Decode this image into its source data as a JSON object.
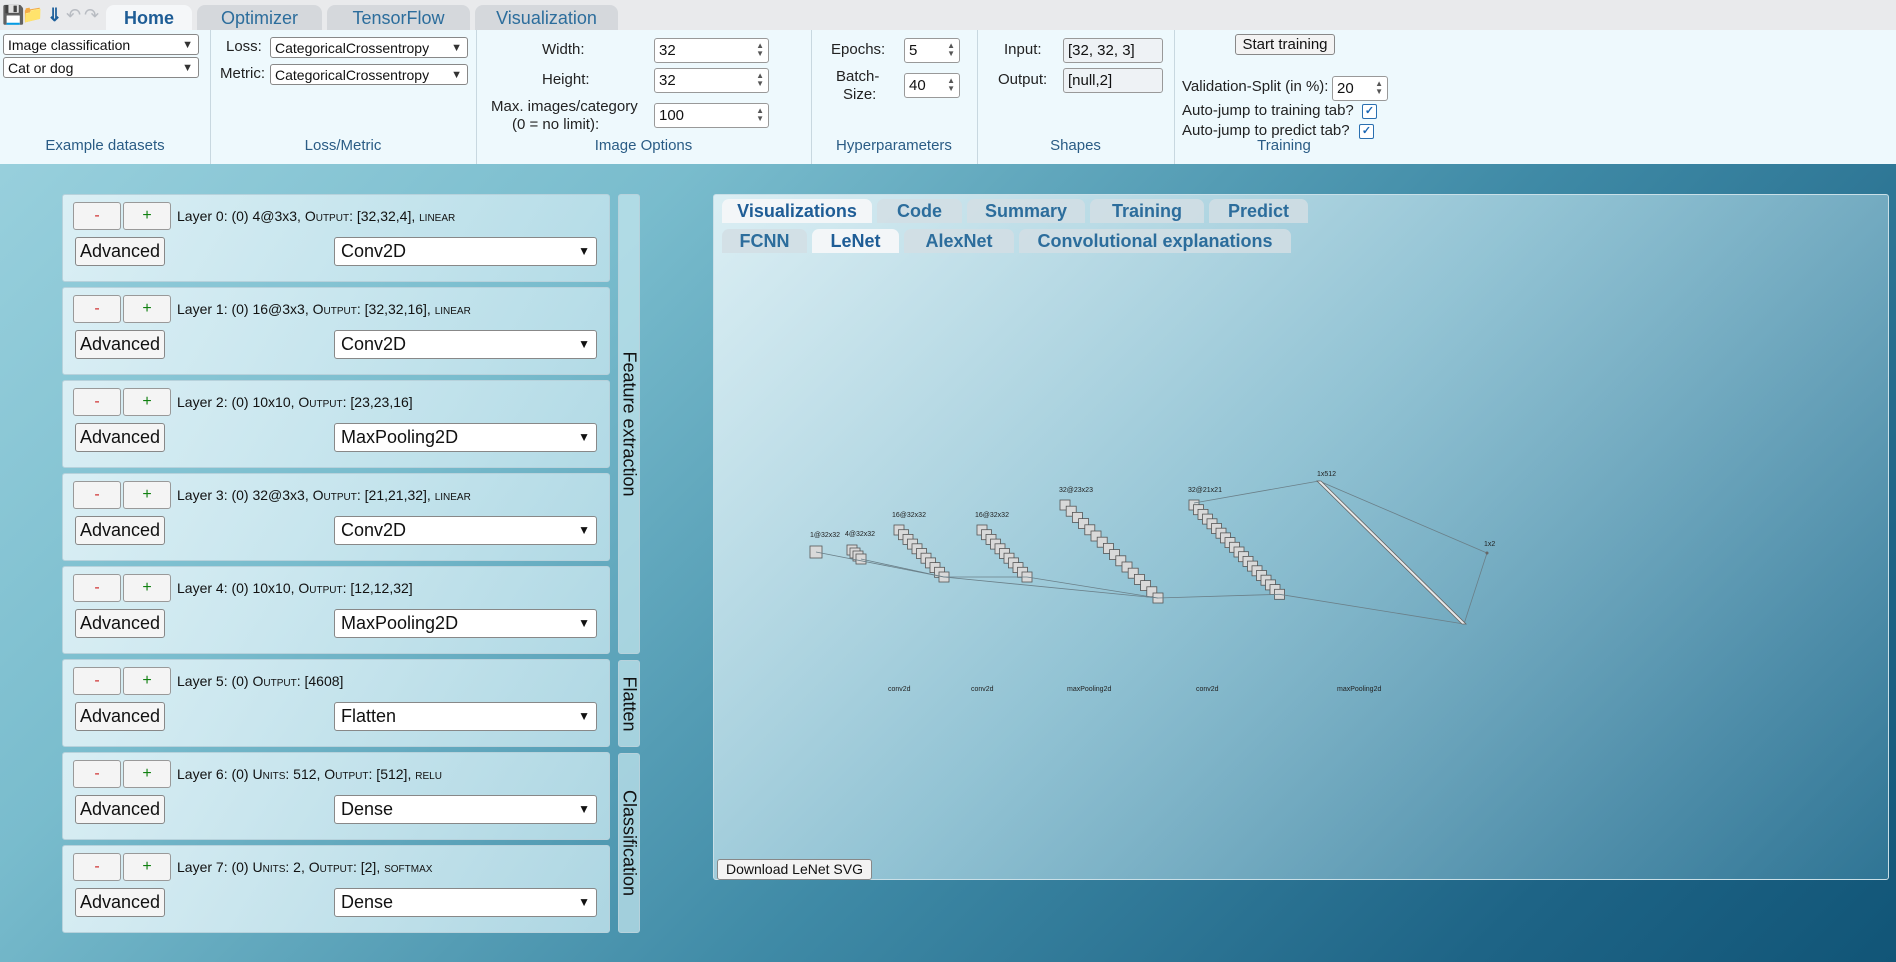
{
  "toolbar": {
    "icons": [
      "save-icon",
      "open-folder-icon",
      "download-icon",
      "undo-icon",
      "redo-icon"
    ],
    "tabs": [
      "Home",
      "Optimizer",
      "TensorFlow",
      "Visualization"
    ],
    "active_tab": "Home"
  },
  "ribbon": {
    "datasets": {
      "category": "Image classification",
      "dataset": "Cat or dog",
      "group_label": "Example datasets"
    },
    "loss_metric": {
      "loss_label": "Loss:",
      "loss_value": "CategoricalCrossentropy",
      "metric_label": "Metric:",
      "metric_value": "CategoricalCrossentropy",
      "group_label": "Loss/Metric"
    },
    "image_options": {
      "width_label": "Width:",
      "width_value": "32",
      "height_label": "Height:",
      "height_value": "32",
      "max_label_1": "Max. images/category",
      "max_label_2": "(0 = no limit):",
      "max_value": "100",
      "group_label": "Image Options"
    },
    "hyperparameters": {
      "epochs_label": "Epochs:",
      "epochs_value": "5",
      "batch_label_1": "Batch-",
      "batch_label_2": "Size:",
      "batch_value": "40",
      "group_label": "Hyperparameters"
    },
    "shapes": {
      "input_label": "Input:",
      "input_value": "[32, 32, 3]",
      "output_label": "Output:",
      "output_value": "[null,2]",
      "group_label": "Shapes"
    },
    "training": {
      "start_button": "Start training",
      "split_label": "Validation-Split (in %):",
      "split_value": "20",
      "jump_train_label": "Auto-jump to training tab?",
      "jump_train_checked": true,
      "jump_predict_label": "Auto-jump to predict tab?",
      "jump_predict_checked": true,
      "group_label": "Training"
    }
  },
  "layers": [
    {
      "minus": "-",
      "plus": "+",
      "info": "Layer 0: (0) 4@3x3, Output: [32,32,4], linear",
      "advanced": "Advanced",
      "type": "Conv2D"
    },
    {
      "minus": "-",
      "plus": "+",
      "info": "Layer 1: (0) 16@3x3, Output: [32,32,16], linear",
      "advanced": "Advanced",
      "type": "Conv2D"
    },
    {
      "minus": "-",
      "plus": "+",
      "info": "Layer 2: (0) 10x10, Output: [23,23,16]",
      "advanced": "Advanced",
      "type": "MaxPooling2D"
    },
    {
      "minus": "-",
      "plus": "+",
      "info": "Layer 3: (0) 32@3x3, Output: [21,21,32], linear",
      "advanced": "Advanced",
      "type": "Conv2D"
    },
    {
      "minus": "-",
      "plus": "+",
      "info": "Layer 4: (0) 10x10, Output: [12,12,32]",
      "advanced": "Advanced",
      "type": "MaxPooling2D"
    },
    {
      "minus": "-",
      "plus": "+",
      "info": "Layer 5: (0) Output: [4608]",
      "advanced": "Advanced",
      "type": "Flatten"
    },
    {
      "minus": "-",
      "plus": "+",
      "info": "Layer 6: (0) Units: 512, Output: [512], relu",
      "advanced": "Advanced",
      "type": "Dense"
    },
    {
      "minus": "-",
      "plus": "+",
      "info": "Layer 7: (0) Units: 2, Output: [2], softmax",
      "advanced": "Advanced",
      "type": "Dense"
    }
  ],
  "layer_groups": [
    "Feature extraction",
    "Flatten",
    "Classification"
  ],
  "vis": {
    "tabs": [
      "Visualizations",
      "Code",
      "Summary",
      "Training",
      "Predict"
    ],
    "active_tab": "Visualizations",
    "subtabs": [
      "FCNN",
      "LeNet",
      "AlexNet",
      "Convolutional explanations"
    ],
    "active_subtab": "LeNet",
    "download_button": "Download LeNet SVG",
    "lenet": {
      "block_labels": [
        "1@32x32",
        "4@32x32",
        "16@32x32",
        "16@32x32",
        "32@23x23",
        "32@21x21",
        "1x512",
        "1x2"
      ],
      "op_labels": [
        "conv2d",
        "conv2d",
        "maxPooling2d",
        "conv2d",
        "maxPooling2d"
      ],
      "stack_counts": [
        1,
        4,
        16,
        16,
        16,
        32
      ]
    }
  }
}
